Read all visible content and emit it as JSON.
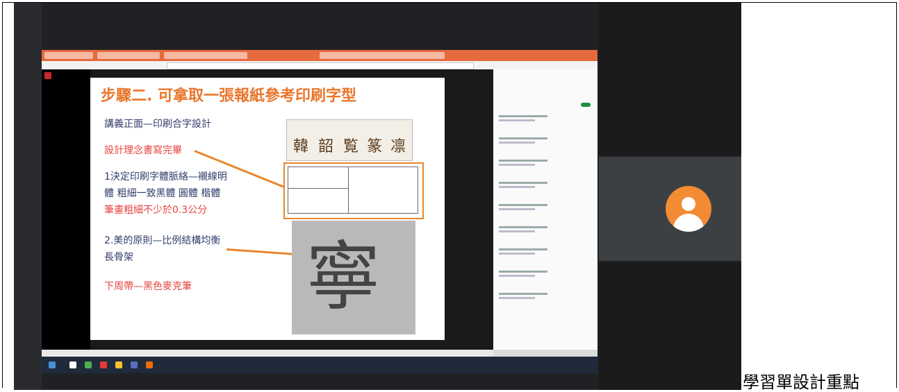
{
  "slide": {
    "title": "步驟二. 可拿取一張報紙參考印刷字型",
    "lines": [
      "講義正面—印刷合字設計",
      "設計理念書寫完畢",
      "1決定印刷字體脈絡—襯線明",
      "體 粗細一致黑體 圓體  楷體",
      "筆畫粗細不少於0.3公分",
      "2.美的原則—比例結構均衡",
      "長骨架",
      "下周帶—黑色麥克筆"
    ],
    "sample_glyphs": [
      "韓",
      "韶",
      "覧",
      "篆",
      "凛"
    ],
    "photo_glyph": "寧"
  },
  "caption": "學習單設計重點",
  "colors": {
    "title": "#e9762b",
    "dark_text": "#333d6b",
    "red_text": "#e6453f",
    "avatar": "#f28b32",
    "meet_background": "#202124"
  },
  "icons": [
    "user-avatar-icon",
    "toggle-icon"
  ]
}
